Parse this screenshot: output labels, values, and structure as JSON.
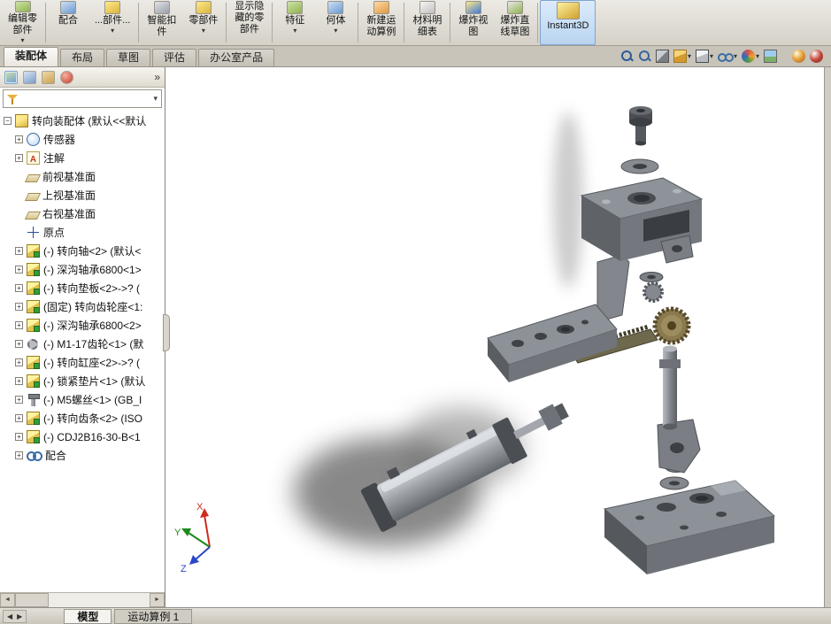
{
  "ribbon": {
    "buttons": [
      {
        "id": "edit-component",
        "lines": [
          "编辑零",
          "部件"
        ],
        "dropdown": true,
        "sep": true
      },
      {
        "id": "mate",
        "lines": [
          "配合"
        ],
        "dropdown": false,
        "sep": false
      },
      {
        "id": "insert-components",
        "lines": [
          "...部件..."
        ],
        "dropdown": true,
        "sep": true
      },
      {
        "id": "smart-fasteners",
        "lines": [
          "智能扣",
          "件"
        ],
        "dropdown": false,
        "sep": false
      },
      {
        "id": "component",
        "lines": [
          "零部件"
        ],
        "dropdown": true,
        "sep": true
      },
      {
        "id": "show-hidden-components",
        "lines": [
          "显示隐",
          "藏的零",
          "部件"
        ],
        "dropdown": false,
        "sep": true
      },
      {
        "id": "features",
        "lines": [
          "特征"
        ],
        "dropdown": true,
        "sep": false
      },
      {
        "id": "reference-geometry",
        "lines": [
          "何体"
        ],
        "dropdown": true,
        "sep": true
      },
      {
        "id": "new-motion-study",
        "lines": [
          "新建运",
          "动算例"
        ],
        "dropdown": false,
        "sep": true
      },
      {
        "id": "bill-of-materials",
        "lines": [
          "材料明",
          "细表"
        ],
        "dropdown": false,
        "sep": true
      },
      {
        "id": "exploded-view",
        "lines": [
          "爆炸视",
          "图"
        ],
        "dropdown": false,
        "sep": false
      },
      {
        "id": "explode-line-sketch",
        "lines": [
          "爆炸直",
          "线草图"
        ],
        "dropdown": false,
        "sep": true
      },
      {
        "id": "instant3d",
        "lines": [
          "Instant3D"
        ],
        "dropdown": false,
        "sep": false,
        "active": true
      }
    ]
  },
  "tabs": {
    "items": [
      {
        "id": "assembly",
        "label": "装配体",
        "active": true
      },
      {
        "id": "layout",
        "label": "布局",
        "active": false
      },
      {
        "id": "sketch",
        "label": "草图",
        "active": false
      },
      {
        "id": "evaluate",
        "label": "评估",
        "active": false
      },
      {
        "id": "office-products",
        "label": "办公室产品",
        "active": false
      }
    ]
  },
  "view_toolbar": [
    {
      "id": "zoom-fit",
      "dropdown": false
    },
    {
      "id": "zoom-area",
      "dropdown": false
    },
    {
      "id": "section-view",
      "dropdown": false
    },
    {
      "id": "view-orientation",
      "dropdown": true
    },
    {
      "id": "display-style",
      "dropdown": true
    },
    {
      "id": "hide-show-items",
      "dropdown": true
    },
    {
      "id": "edit-appearance",
      "dropdown": true
    },
    {
      "id": "apply-scene",
      "dropdown": false
    },
    {
      "id": "realview",
      "dropdown": false,
      "gap": true
    },
    {
      "id": "options",
      "dropdown": false
    }
  ],
  "panel": {
    "tabs": [
      {
        "id": "featuremanager"
      },
      {
        "id": "propertymanager"
      },
      {
        "id": "configurationmanager"
      },
      {
        "id": "displaymanager"
      }
    ],
    "chevron": "»",
    "scroll_left": "◄",
    "scroll_right": "►"
  },
  "feature_tree": {
    "items": [
      {
        "id": "root-assembly",
        "icon": "assembly",
        "expand": "minus",
        "depth": 0,
        "label": "转向装配体 (默认<<默认"
      },
      {
        "id": "sensors",
        "icon": "sensors",
        "expand": "plus",
        "depth": 1,
        "label": "传感器"
      },
      {
        "id": "annotations",
        "icon": "annotations",
        "expand": "plus",
        "depth": 1,
        "label": "注解"
      },
      {
        "id": "front-plane",
        "icon": "plane",
        "expand": "none",
        "depth": 1,
        "label": "前视基准面"
      },
      {
        "id": "top-plane",
        "icon": "plane",
        "expand": "none",
        "depth": 1,
        "label": "上视基准面"
      },
      {
        "id": "right-plane",
        "icon": "plane",
        "expand": "none",
        "depth": 1,
        "label": "右视基准面"
      },
      {
        "id": "origin",
        "icon": "origin",
        "expand": "none",
        "depth": 1,
        "label": "原点"
      },
      {
        "id": "steering-shaft",
        "icon": "part",
        "expand": "plus",
        "depth": 1,
        "label": "(-) 转向轴<2> (默认<"
      },
      {
        "id": "bearing-6800-1",
        "icon": "part",
        "expand": "plus",
        "depth": 1,
        "label": "(-) 深沟轴承6800<1>"
      },
      {
        "id": "steering-pad",
        "icon": "part",
        "expand": "plus",
        "depth": 1,
        "label": "(-) 转向垫板<2>->? ("
      },
      {
        "id": "gear-seat",
        "icon": "part",
        "expand": "plus",
        "depth": 1,
        "label": "(固定) 转向齿轮座<1:"
      },
      {
        "id": "bearing-6800-2",
        "icon": "part",
        "expand": "plus",
        "depth": 1,
        "label": "(-) 深沟轴承6800<2>"
      },
      {
        "id": "gear-m1-17",
        "icon": "gear",
        "expand": "plus",
        "depth": 1,
        "label": "(-) M1-17齿轮<1> (默"
      },
      {
        "id": "cylinder-seat",
        "icon": "part",
        "expand": "plus",
        "depth": 1,
        "label": "(-) 转向缸座<2>->? ("
      },
      {
        "id": "lock-washer",
        "icon": "part",
        "expand": "plus",
        "depth": 1,
        "label": "(-) 锁紧垫片<1> (默认"
      },
      {
        "id": "m5-screw",
        "icon": "screw",
        "expand": "plus",
        "depth": 1,
        "label": "(-) M5螺丝<1> (GB_I"
      },
      {
        "id": "steering-rack",
        "icon": "part",
        "expand": "plus",
        "depth": 1,
        "label": "(-) 转向齿条<2> (ISO"
      },
      {
        "id": "cdj2b16",
        "icon": "part",
        "expand": "plus",
        "depth": 1,
        "label": "(-) CDJ2B16-30-B<1"
      },
      {
        "id": "mates",
        "icon": "mates",
        "expand": "plus",
        "depth": 1,
        "label": "配合"
      }
    ]
  },
  "viewport": {
    "triad": {
      "x": "X",
      "y": "Y",
      "z": "Z"
    }
  },
  "statusbar": {
    "nav_left": "◀",
    "nav_right": "▶",
    "model_tab": "模型",
    "motion_tab": "运动算例 1"
  }
}
